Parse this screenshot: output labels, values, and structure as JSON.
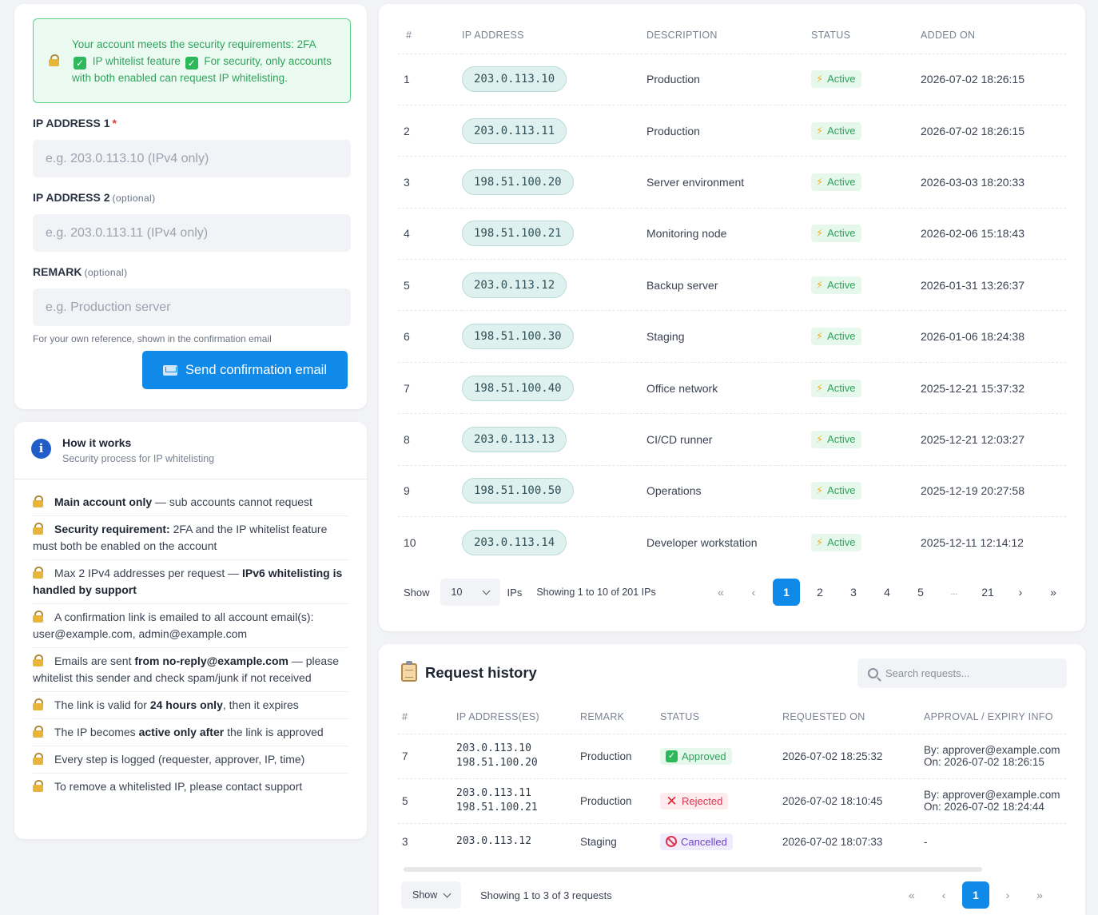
{
  "form": {
    "notice": {
      "part1": "Your account meets the security requirements: 2FA",
      "check1": "✓",
      "part2": "IP whitelist feature",
      "check2": "✓",
      "part3": "For security, only accounts with both enabled can request IP whitelisting."
    },
    "ip1_label": "IP ADDRESS 1",
    "ip1_required": "*",
    "ip1_placeholder": "e.g. 203.0.113.10 (IPv4 only)",
    "ip2_label": "IP ADDRESS 2",
    "ip2_optional": "(optional)",
    "ip2_placeholder": "e.g. 203.0.113.11 (IPv4 only)",
    "remark_label": "REMARK",
    "remark_optional": "(optional)",
    "remark_placeholder": "e.g. Production server",
    "remark_hint": "For your own reference, shown in the confirmation email",
    "send_button": "Send confirmation email"
  },
  "how": {
    "icon": "i",
    "title": "How it works",
    "subtitle": "Security process for IP whitelisting",
    "items": [
      {
        "b1": "Main account only",
        "t1": " — sub accounts cannot request"
      },
      {
        "b1": "Security requirement:",
        "t1": " 2FA and the IP whitelist feature must both be enabled on the account"
      },
      {
        "t0": "Max 2 IPv4 addresses per request — ",
        "b1": "IPv6 whitelisting is handled by support"
      },
      {
        "t0": "A confirmation link is emailed to all account email(s): user@example.com, admin@example.com"
      },
      {
        "t0": "Emails are sent ",
        "b1": "from no-reply@example.com",
        "t1": " — please whitelist this sender and check spam/junk if not received"
      },
      {
        "t0": "The link is valid for ",
        "b1": "24 hours only",
        "t1": ", then it expires"
      },
      {
        "t0": "The IP becomes ",
        "b1": "active only after",
        "t1": " the link is approved"
      },
      {
        "t0": "Every step is logged (requester, approver, IP, time)"
      },
      {
        "t0": "To remove a whitelisted IP, please contact support"
      }
    ]
  },
  "ip_table": {
    "headers": [
      "#",
      "IP ADDRESS",
      "DESCRIPTION",
      "STATUS",
      "ADDED ON"
    ],
    "rows": [
      {
        "n": "1",
        "ip": "203.0.113.10",
        "desc": "Production",
        "status": "Active",
        "added": "2026-07-02 18:26:15"
      },
      {
        "n": "2",
        "ip": "203.0.113.11",
        "desc": "Production",
        "status": "Active",
        "added": "2026-07-02 18:26:15"
      },
      {
        "n": "3",
        "ip": "198.51.100.20",
        "desc": "Server environment",
        "status": "Active",
        "added": "2026-03-03 18:20:33"
      },
      {
        "n": "4",
        "ip": "198.51.100.21",
        "desc": "Monitoring node",
        "status": "Active",
        "added": "2026-02-06 15:18:43"
      },
      {
        "n": "5",
        "ip": "203.0.113.12",
        "desc": "Backup server",
        "status": "Active",
        "added": "2026-01-31 13:26:37"
      },
      {
        "n": "6",
        "ip": "198.51.100.30",
        "desc": "Staging",
        "status": "Active",
        "added": "2026-01-06 18:24:38"
      },
      {
        "n": "7",
        "ip": "198.51.100.40",
        "desc": "Office network",
        "status": "Active",
        "added": "2025-12-21 15:37:32"
      },
      {
        "n": "8",
        "ip": "203.0.113.13",
        "desc": "CI/CD runner",
        "status": "Active",
        "added": "2025-12-21 12:03:27"
      },
      {
        "n": "9",
        "ip": "198.51.100.50",
        "desc": "Operations",
        "status": "Active",
        "added": "2025-12-19 20:27:58"
      },
      {
        "n": "10",
        "ip": "203.0.113.14",
        "desc": "Developer workstation",
        "status": "Active",
        "added": "2025-12-11 12:14:12"
      }
    ],
    "bolt": "⚡",
    "pager": {
      "show_label": "Show",
      "page_size": "10",
      "unit": "IPs",
      "summary": "Showing 1 to 10 of 201 IPs",
      "first": "«",
      "prev": "‹",
      "next": "›",
      "last": "»",
      "pages": [
        "1",
        "2",
        "3",
        "4",
        "5",
        "...",
        "21"
      ],
      "current": "1"
    }
  },
  "history": {
    "title": "Request history",
    "search_placeholder": "Search requests...",
    "headers": [
      "#",
      "IP ADDRESS(ES)",
      "REMARK",
      "STATUS",
      "REQUESTED ON",
      "APPROVAL / EXPIRY INFO"
    ],
    "rows": [
      {
        "n": "7",
        "ip1": "203.0.113.10",
        "ip2": "198.51.100.20",
        "remark": "Production",
        "status": "Approved",
        "status_icon": "✓",
        "requested": "2026-07-02 18:25:32",
        "info1": "By: approver@example.com",
        "info2": "On: 2026-07-02 18:26:15"
      },
      {
        "n": "5",
        "ip1": "203.0.113.11",
        "ip2": "198.51.100.21",
        "remark": "Production",
        "status": "Rejected",
        "status_icon": "✕",
        "requested": "2026-07-02 18:10:45",
        "info1": "By: approver@example.com",
        "info2": "On: 2026-07-02 18:24:44"
      },
      {
        "n": "3",
        "ip1": "203.0.113.12",
        "ip2": "",
        "remark": "Staging",
        "status": "Cancelled",
        "status_icon": "",
        "requested": "2026-07-02 18:07:33",
        "info1": "-",
        "info2": ""
      }
    ],
    "pager": {
      "show_label": "Show",
      "summary": "Showing 1 to 3 of 3 requests",
      "first": "«",
      "prev": "‹",
      "next": "›",
      "last": "»",
      "current": "1"
    }
  },
  "colors": {
    "accent": "#0f8ae8",
    "success": "#2fa35c",
    "danger": "#e0334f",
    "cancelled": "#6d3fcf"
  }
}
